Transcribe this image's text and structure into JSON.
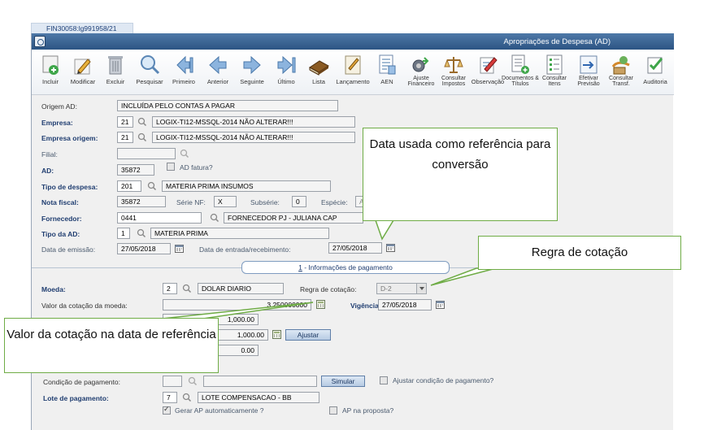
{
  "tab": {
    "label": "FIN30058:lg991958/21"
  },
  "window": {
    "title": "Apropriações de Despesa (AD)"
  },
  "toolbar": [
    {
      "name": "incluir",
      "label": "Incluir",
      "icon": "add-document-icon"
    },
    {
      "name": "modificar",
      "label": "Modificar",
      "icon": "edit-pencil-icon"
    },
    {
      "name": "excluir",
      "label": "Excluir",
      "icon": "trash-icon"
    },
    {
      "name": "pesquisar",
      "label": "Pesquisar",
      "icon": "search-icon"
    },
    {
      "name": "primeiro",
      "label": "Primeiro",
      "icon": "first-icon"
    },
    {
      "name": "anterior",
      "label": "Anterior",
      "icon": "previous-icon"
    },
    {
      "name": "seguinte",
      "label": "Seguinte",
      "icon": "next-icon"
    },
    {
      "name": "ultimo",
      "label": "Último",
      "icon": "last-icon"
    },
    {
      "name": "lista",
      "label": "Lista",
      "icon": "book-icon"
    },
    {
      "name": "lancamento",
      "label": "Lançamento",
      "icon": "posting-icon"
    },
    {
      "name": "aen",
      "label": "AEN",
      "icon": "report-icon"
    },
    {
      "name": "ajuste-financeiro",
      "label": "Ajuste Financeiro",
      "icon": "adjust-icon"
    },
    {
      "name": "consultar-impostos",
      "label": "Consultar Impostos",
      "icon": "scale-icon"
    },
    {
      "name": "observacao",
      "label": "Observação",
      "icon": "note-icon"
    },
    {
      "name": "documentos-titulos",
      "label": "Documentos & Títulos",
      "icon": "documents-icon"
    },
    {
      "name": "consultar-itens",
      "label": "Consultar Itens",
      "icon": "items-icon"
    },
    {
      "name": "efetivar-previsao",
      "label": "Efetivar Previsão",
      "icon": "commit-icon"
    },
    {
      "name": "consultar-transf",
      "label": "Consultar Transf.",
      "icon": "transfer-icon"
    },
    {
      "name": "auditoria",
      "label": "Auditoria",
      "icon": "audit-icon"
    }
  ],
  "form": {
    "origem_ad": {
      "label": "Origem AD:",
      "value": "INCLUÍDA PELO CONTAS A PAGAR"
    },
    "empresa": {
      "label": "Empresa:",
      "code": "21",
      "name": "LOGIX-TI12-MSSQL-2014 NÃO ALTERAR!!!"
    },
    "empresa_origem": {
      "label": "Empresa origem:",
      "code": "21",
      "name": "LOGIX-TI12-MSSQL-2014 NÃO ALTERAR!!!"
    },
    "filial": {
      "label": "Filial:",
      "value": ""
    },
    "ad": {
      "label": "AD:",
      "value": "35872",
      "fatura_label": "AD fatura?"
    },
    "tipo_despesa": {
      "label": "Tipo de despesa:",
      "code": "201",
      "name": "MATERIA PRIMA INSUMOS"
    },
    "nota_fiscal": {
      "label": "Nota fiscal:",
      "value": "35872",
      "serie_label": "Série NF:",
      "serie": "X",
      "subserie_label": "Subsérie:",
      "subserie": "0",
      "especie_label": "Espécie:",
      "especie": "A"
    },
    "fornecedor": {
      "label": "Fornecedor:",
      "code": "0441",
      "name": "FORNECEDOR PJ - JULIANA CAP"
    },
    "tipo_ad": {
      "label": "Tipo da AD:",
      "code": "1",
      "name": "MATERIA PRIMA"
    },
    "data_emissao": {
      "label": "Data de emissão:",
      "value": "27/05/2018"
    },
    "data_entrada": {
      "label": "Data de entrada/recebimento:",
      "value": "27/05/2018"
    }
  },
  "section": {
    "number": "1",
    "title": " - Informações de pagamento"
  },
  "pagamento": {
    "moeda": {
      "label": "Moeda:",
      "code": "2",
      "name": "DOLAR DIARIO"
    },
    "regra_cotacao": {
      "label": "Regra de cotação:",
      "value": "D-2"
    },
    "valor_cotacao": {
      "label": "Valor da cotação da moeda:",
      "value": "3.250000000"
    },
    "vigencia": {
      "label": "Vigência:",
      "value": "27/05/2018"
    },
    "valor1": "1,000.00",
    "valor2": "1,000.00",
    "ajustar_button": "Ajustar",
    "valor3": "0.00",
    "condicao": {
      "label": "Condição de pagamento:",
      "code": "",
      "name": "",
      "simular": "Simular",
      "ajustar_label": "Ajustar condição de pagamento?"
    },
    "lote": {
      "label": "Lote de pagamento:",
      "code": "7",
      "name": "LOTE COMPENSACAO   - BB"
    },
    "gerar_ap": "Gerar AP automaticamente ?",
    "ap_proposta": "AP na proposta?"
  },
  "callouts": {
    "data_usada": "Data usada como referência para conversão",
    "regra": "Regra de cotação",
    "valor": "Valor da cotação na data de referência"
  },
  "colors": {
    "titlebar": "#2c5483",
    "label_bold": "#1f3d70",
    "callout_border": "#6fac46"
  }
}
